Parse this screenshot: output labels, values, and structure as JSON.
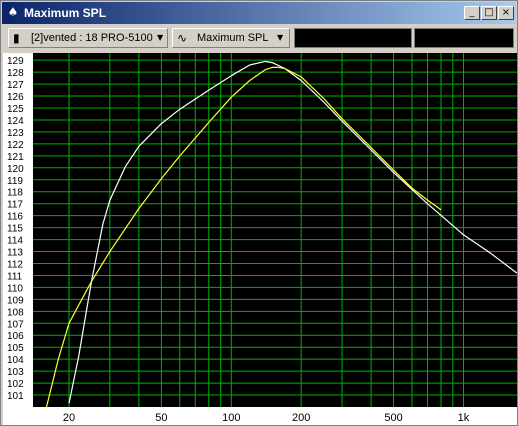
{
  "window": {
    "title": "Maximum SPL",
    "app_icon": "speaker-app-icon",
    "controls": {
      "minimize": "_",
      "maximize": "□",
      "close": "×"
    }
  },
  "toolbar": {
    "driver_combo": {
      "icon": "speaker-icon",
      "label": "[2]vented : 18 PRO-5100",
      "arrow": "▼"
    },
    "graph_combo": {
      "icon": "sine-wave-icon",
      "label": "Maximum SPL",
      "arrow": "▼"
    }
  },
  "colors": {
    "plot_background": "#000000",
    "grid": "#00b000",
    "label_background": "#ffffff",
    "curve_white": "#ffffff",
    "curve_yellow": "#ffff33"
  },
  "chart_data": {
    "type": "line",
    "title": "",
    "xlabel": "",
    "ylabel": "",
    "x_scale": "log",
    "xlim": [
      14,
      1700
    ],
    "ylim": [
      100,
      129.6
    ],
    "x_tick_labels": [
      {
        "value": 20,
        "label": "20"
      },
      {
        "value": 50,
        "label": "50"
      },
      {
        "value": 100,
        "label": "100"
      },
      {
        "value": 200,
        "label": "200"
      },
      {
        "value": 500,
        "label": "500"
      },
      {
        "value": 1000,
        "label": "1k"
      }
    ],
    "y_ticks": [
      101,
      102,
      103,
      104,
      105,
      106,
      107,
      108,
      109,
      110,
      111,
      112,
      113,
      114,
      115,
      116,
      117,
      118,
      119,
      120,
      121,
      122,
      123,
      124,
      125,
      126,
      127,
      128,
      129
    ],
    "grid": true,
    "series": [
      {
        "color": "#ffffff",
        "x": [
          20,
          22,
          25,
          28,
          30,
          35,
          40,
          50,
          60,
          80,
          100,
          120,
          140,
          150,
          170,
          200,
          250,
          300,
          400,
          500,
          700,
          1000,
          1300,
          1700
        ],
        "y": [
          100.3,
          104.2,
          110.5,
          115.3,
          117.3,
          120.1,
          121.8,
          123.7,
          124.9,
          126.5,
          127.7,
          128.6,
          128.9,
          128.8,
          128.3,
          127.3,
          125.5,
          123.9,
          121.5,
          119.6,
          117.0,
          114.4,
          112.9,
          111.2
        ]
      },
      {
        "color": "#ffff33",
        "x": [
          16,
          18,
          20,
          22,
          25,
          30,
          40,
          50,
          60,
          80,
          100,
          120,
          140,
          150,
          160,
          170,
          200,
          250,
          300,
          400,
          500,
          600,
          700,
          800
        ],
        "y": [
          100.0,
          104.0,
          107.0,
          108.5,
          110.5,
          113.0,
          116.6,
          119.1,
          121.0,
          123.8,
          125.9,
          127.3,
          128.2,
          128.4,
          128.4,
          128.3,
          127.6,
          125.8,
          124.1,
          121.7,
          119.8,
          118.3,
          117.3,
          116.5
        ]
      }
    ]
  }
}
